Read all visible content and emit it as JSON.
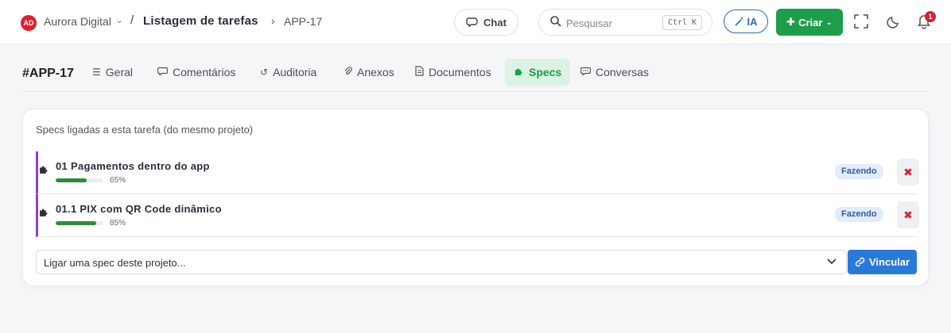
{
  "header": {
    "org_badge": "AD",
    "org_name": "Aurora Digital",
    "breadcrumb_sep": "/",
    "breadcrumb_list": "Listagem de tarefas",
    "breadcrumb_arrow": "›",
    "breadcrumb_current": "APP-17",
    "chat_label": "Chat",
    "search_placeholder": "Pesquisar",
    "search_shortcut": "Ctrl K",
    "ia_label": "IA",
    "criar_label": "Criar",
    "notification_count": "1"
  },
  "tabs": {
    "task_id": "#APP-17",
    "items": [
      {
        "label": "Geral",
        "icon": "list-icon"
      },
      {
        "label": "Comentários",
        "icon": "comment-icon"
      },
      {
        "label": "Auditoria",
        "icon": "history-icon"
      },
      {
        "label": "Anexos",
        "icon": "paperclip-icon"
      },
      {
        "label": "Documentos",
        "icon": "document-icon"
      },
      {
        "label": "Specs",
        "icon": "puzzle-icon",
        "active": true
      },
      {
        "label": "Conversas",
        "icon": "chat-icon"
      }
    ]
  },
  "specs": {
    "title": "Specs ligadas a esta tarefa (do mesmo projeto)",
    "items": [
      {
        "name": "01 Pagamentos dentro do app",
        "progress": 0.65,
        "progress_label": "65%",
        "status": "Fazendo"
      },
      {
        "name": "01.1 PIX com QR Code dinâmico",
        "progress": 0.85,
        "progress_label": "85%",
        "status": "Fazendo"
      }
    ],
    "select_value": "Ligar uma spec deste projeto...",
    "link_button": "Vincular"
  },
  "colors": {
    "accent_green": "#1e9e4a",
    "accent_blue": "#2979d6",
    "spec_border": "#8b3fd6",
    "danger": "#d1283c"
  }
}
